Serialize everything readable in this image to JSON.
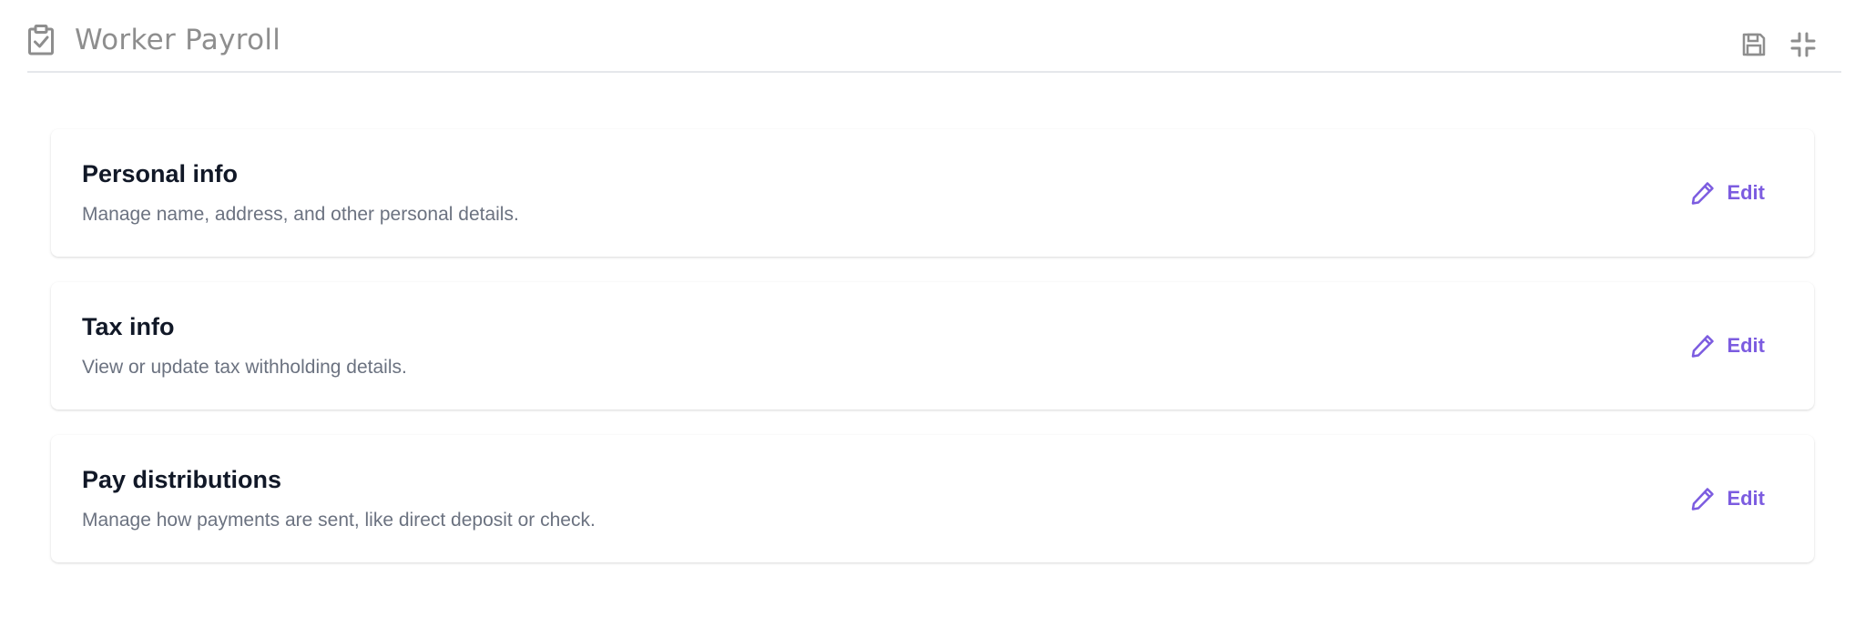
{
  "header": {
    "title": "Worker Payroll",
    "left_icon": "clipboard-check-icon",
    "actions": [
      {
        "name": "save",
        "icon": "floppy-disk-icon"
      },
      {
        "name": "minimize",
        "icon": "collapse-arrows-icon"
      }
    ]
  },
  "sections": [
    {
      "title": "Personal info",
      "description": "Manage name, address, and other personal details.",
      "edit_label": "Edit"
    },
    {
      "title": "Tax info",
      "description": "View or update tax withholding details.",
      "edit_label": "Edit"
    },
    {
      "title": "Pay distributions",
      "description": "Manage how payments are sent, like direct deposit or check.",
      "edit_label": "Edit"
    }
  ],
  "colors": {
    "accent": "#7c5ce0",
    "title_text": "#111827",
    "muted_text": "#6b7280",
    "header_text": "#8e8e8e",
    "divider": "#e5e7eb"
  }
}
